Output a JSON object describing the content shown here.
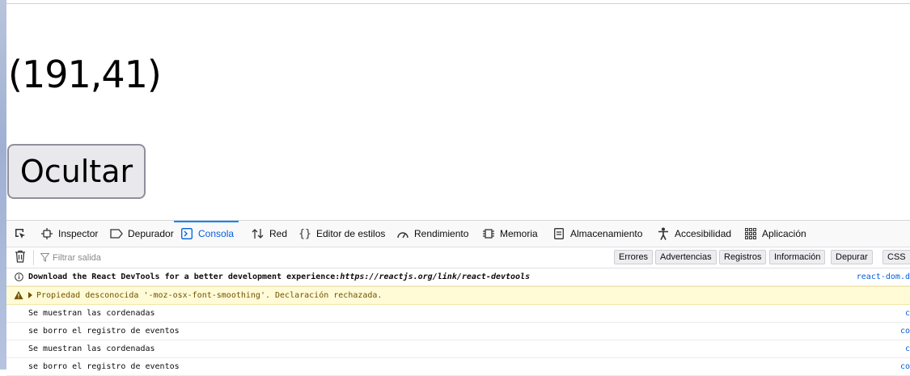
{
  "page": {
    "coordinates": "(191,41)",
    "ocultar_label": "Ocultar"
  },
  "devtools": {
    "tabs": [
      {
        "label": "Inspector",
        "icon": "inspector-icon"
      },
      {
        "label": "Depurador",
        "icon": "debugger-icon"
      },
      {
        "label": "Consola",
        "icon": "console-icon",
        "active": true
      },
      {
        "label": "Red",
        "icon": "network-icon"
      },
      {
        "label": "Editor de estilos",
        "icon": "style-editor-icon"
      },
      {
        "label": "Rendimiento",
        "icon": "performance-icon"
      },
      {
        "label": "Memoria",
        "icon": "memory-icon"
      },
      {
        "label": "Almacenamiento",
        "icon": "storage-icon"
      },
      {
        "label": "Accesibilidad",
        "icon": "accessibility-icon"
      },
      {
        "label": "Aplicación",
        "icon": "application-icon"
      }
    ],
    "filter_placeholder": "Filtrar salida",
    "filter_buttons": [
      "Errores",
      "Advertencias",
      "Registros",
      "Información",
      "Depurar",
      "CSS"
    ],
    "messages": [
      {
        "type": "info",
        "text_before": "Download the React DevTools for a better development experience: ",
        "link": "https://reactjs.org/link/react-devtools",
        "source": "react-dom.d"
      },
      {
        "type": "warning",
        "text": "Propiedad desconocida '-moz-osx-font-smoothing'.  Declaración rechazada.",
        "source": ""
      },
      {
        "type": "log",
        "text": "Se muestran las cordenadas",
        "source": "c"
      },
      {
        "type": "log",
        "text": "se borro el registro de eventos",
        "source": "co"
      },
      {
        "type": "log",
        "text": "Se muestran las cordenadas",
        "source": "c"
      },
      {
        "type": "log",
        "text": "se borro el registro de eventos",
        "source": "co"
      }
    ]
  },
  "colors": {
    "active_tab": "#0060df",
    "warning_bg": "#fffbd6",
    "warning_text": "#715100"
  }
}
